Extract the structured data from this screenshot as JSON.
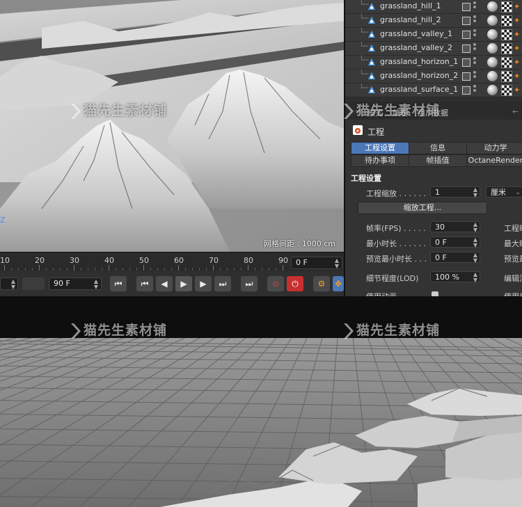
{
  "object_manager": {
    "objects": [
      {
        "name": "grassland_hill_1"
      },
      {
        "name": "grassland_hill_2"
      },
      {
        "name": "grassland_valley_1"
      },
      {
        "name": "grassland_valley_2"
      },
      {
        "name": "grassland_horizon_1"
      },
      {
        "name": "grassland_horizon_2"
      },
      {
        "name": "grassland_surface_1"
      }
    ]
  },
  "attributes": {
    "topbar": {
      "mode": "模式",
      "edit": "编辑",
      "user_data": "用户数据"
    },
    "object_title": "工程",
    "tabs_row1": [
      "工程设置",
      "信息",
      "动力学"
    ],
    "tabs_row2": [
      "待办事项",
      "帧插值",
      "OctaneRender"
    ],
    "active_tab": "工程设置",
    "section_title": "工程设置",
    "project_scale": {
      "label": "工程缩放",
      "value": "1",
      "unit": "厘米"
    },
    "scale_button": "缩放工程...",
    "fps": {
      "label": "帧率(FPS)",
      "value": "30"
    },
    "min_time": {
      "label": "最小时长",
      "value": "0 F"
    },
    "preview_min": {
      "label": "预览最小时长",
      "value": "0 F"
    },
    "lod": {
      "label": "细节程度(LOD)",
      "value": "100 %"
    },
    "use_anim": {
      "label": "使用动画"
    },
    "right_labels": [
      "工程时",
      "最大时",
      "预览最",
      "编辑渲",
      "使用表"
    ]
  },
  "viewport": {
    "grid_spacing": "网格间距 : 1000 cm",
    "axis_label": "Z"
  },
  "timeline": {
    "ticks": [
      "10",
      "20",
      "30",
      "40",
      "50",
      "60",
      "70",
      "80",
      "90"
    ],
    "current_frame": "0 F"
  },
  "transport": {
    "end_frame": "90 F"
  },
  "watermark": {
    "text": "猫先生素材铺"
  },
  "colors": {
    "accent_blue": "#4d78b8",
    "orange_icon": "#e08a2a",
    "panel": "#333333"
  }
}
